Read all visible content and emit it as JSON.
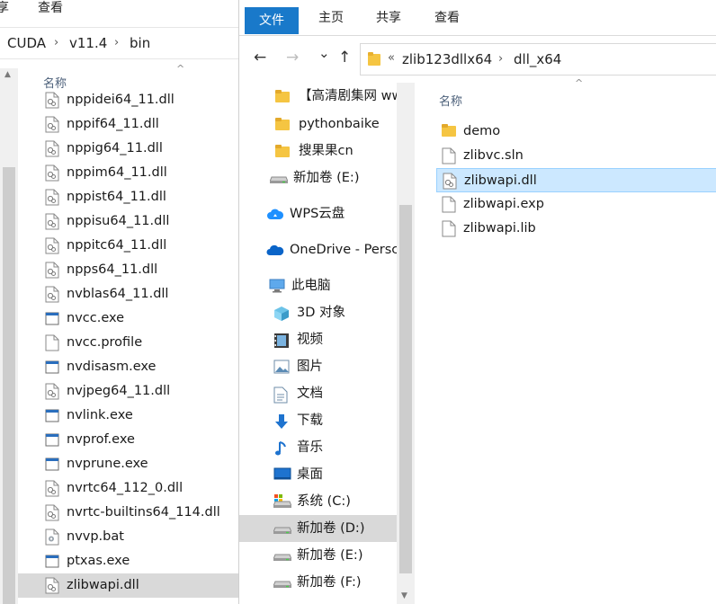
{
  "back_window": {
    "ribbon_tabs": [
      "享",
      "查看"
    ],
    "breadcrumb": [
      "CUDA",
      "v11.4",
      "bin"
    ],
    "column_name": "名称",
    "files": [
      {
        "name": "nppidei64_11.dll",
        "icon": "dll-file-icon"
      },
      {
        "name": "nppif64_11.dll",
        "icon": "dll-file-icon"
      },
      {
        "name": "nppig64_11.dll",
        "icon": "dll-file-icon"
      },
      {
        "name": "nppim64_11.dll",
        "icon": "dll-file-icon"
      },
      {
        "name": "nppist64_11.dll",
        "icon": "dll-file-icon"
      },
      {
        "name": "nppisu64_11.dll",
        "icon": "dll-file-icon"
      },
      {
        "name": "nppitc64_11.dll",
        "icon": "dll-file-icon"
      },
      {
        "name": "npps64_11.dll",
        "icon": "dll-file-icon"
      },
      {
        "name": "nvblas64_11.dll",
        "icon": "dll-file-icon"
      },
      {
        "name": "nvcc.exe",
        "icon": "exe-file-icon"
      },
      {
        "name": "nvcc.profile",
        "icon": "generic-file-icon"
      },
      {
        "name": "nvdisasm.exe",
        "icon": "exe-file-icon"
      },
      {
        "name": "nvjpeg64_11.dll",
        "icon": "dll-file-icon"
      },
      {
        "name": "nvlink.exe",
        "icon": "exe-file-icon"
      },
      {
        "name": "nvprof.exe",
        "icon": "exe-file-icon"
      },
      {
        "name": "nvprune.exe",
        "icon": "exe-file-icon"
      },
      {
        "name": "nvrtc64_112_0.dll",
        "icon": "dll-file-icon"
      },
      {
        "name": "nvrtc-builtins64_114.dll",
        "icon": "dll-file-icon"
      },
      {
        "name": "nvvp.bat",
        "icon": "bat-file-icon"
      },
      {
        "name": "ptxas.exe",
        "icon": "exe-file-icon"
      },
      {
        "name": "zlibwapi.dll",
        "icon": "dll-file-icon",
        "selected": true
      }
    ]
  },
  "front_window": {
    "ribbon": {
      "file": "文件",
      "home": "主页",
      "share": "共享",
      "view": "查看"
    },
    "nav": {
      "back": "←",
      "forward": "→",
      "recent": "⌄",
      "up": "↑"
    },
    "address": {
      "overflow": "«",
      "crumbs": [
        "zlib123dllx64",
        "dll_x64"
      ]
    },
    "nav_pane": [
      {
        "label": "【高清剧集网 ww",
        "icon": "folder-icon"
      },
      {
        "label": "pythonbaike",
        "icon": "folder-icon"
      },
      {
        "label": "搜果果cn",
        "icon": "folder-icon"
      },
      {
        "label": "新加卷 (E:)",
        "icon": "drive-icon"
      },
      {
        "label": "WPS云盘",
        "icon": "cloud-icon"
      },
      {
        "label": "OneDrive - Persc",
        "icon": "onedrive-icon"
      },
      {
        "label": "此电脑",
        "icon": "computer-icon"
      },
      {
        "label": "3D 对象",
        "icon": "cube-icon"
      },
      {
        "label": "视频",
        "icon": "video-icon"
      },
      {
        "label": "图片",
        "icon": "picture-icon"
      },
      {
        "label": "文档",
        "icon": "document-icon"
      },
      {
        "label": "下载",
        "icon": "download-icon"
      },
      {
        "label": "音乐",
        "icon": "music-icon"
      },
      {
        "label": "桌面",
        "icon": "desktop-icon"
      },
      {
        "label": "系统 (C:)",
        "icon": "system-drive-icon"
      },
      {
        "label": "新加卷 (D:)",
        "icon": "drive-icon",
        "selected": true
      },
      {
        "label": "新加卷 (E:)",
        "icon": "drive-icon"
      },
      {
        "label": "新加卷 (F:)",
        "icon": "drive-icon"
      }
    ],
    "column_name": "名称",
    "files": [
      {
        "name": "demo",
        "icon": "folder-icon"
      },
      {
        "name": "zlibvc.sln",
        "icon": "generic-file-icon"
      },
      {
        "name": "zlibwapi.dll",
        "icon": "dll-file-icon",
        "selected": true
      },
      {
        "name": "zlibwapi.exp",
        "icon": "generic-file-icon"
      },
      {
        "name": "zlibwapi.lib",
        "icon": "generic-file-icon"
      }
    ]
  },
  "colors": {
    "file_tab": "#1979ca",
    "selection": "#cce8ff",
    "selection_border": "#99d1ff",
    "inactive_selection": "#d9d9d9"
  }
}
